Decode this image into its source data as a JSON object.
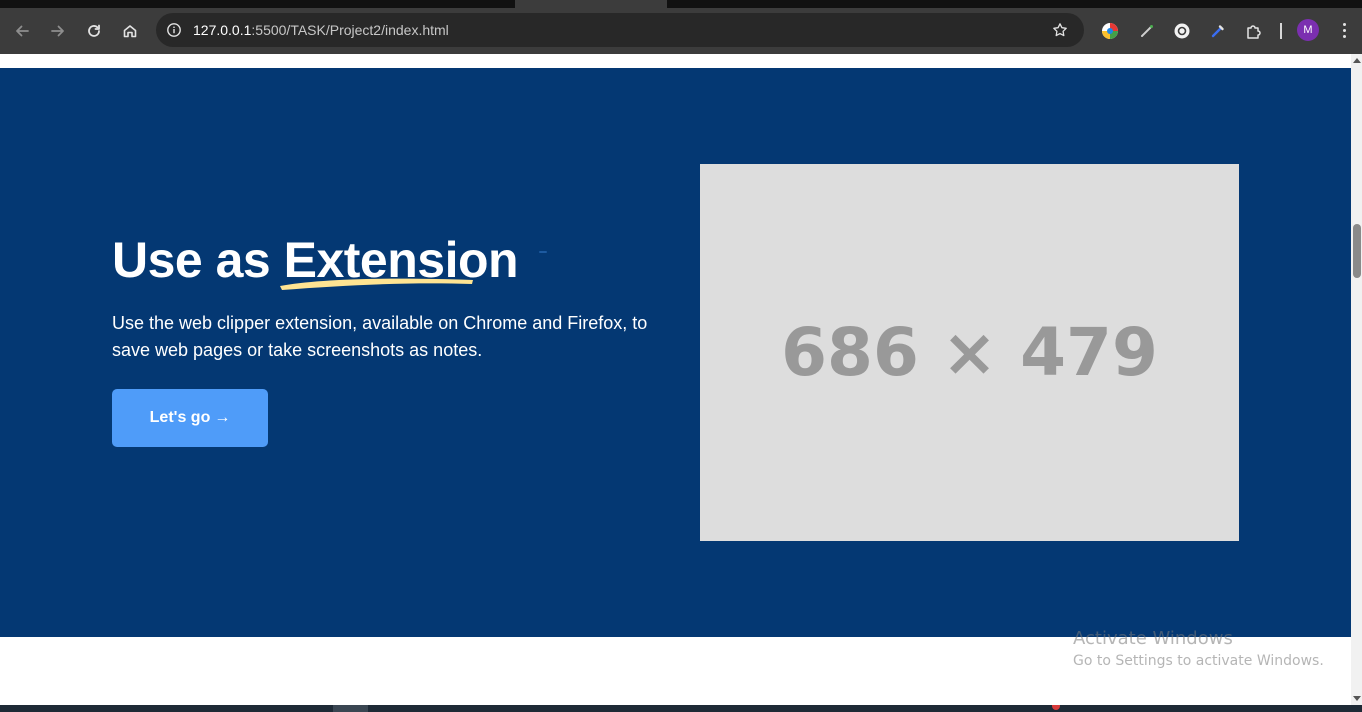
{
  "browser": {
    "url_host": "127.0.0.1",
    "url_rest": ":5500/TASK/Project2/index.html",
    "profile_initial": "M",
    "icons": [
      "back-icon",
      "forward-icon",
      "reload-icon",
      "home-icon",
      "site-info-icon",
      "bookmark-star-icon",
      "extension-icon",
      "puzzle-icon",
      "menu-icon"
    ]
  },
  "hero": {
    "title_prefix": "Use as ",
    "title_highlight": "Extension",
    "description": "Use the web clipper extension, available on Chrome and Firefox, to save web pages or take screenshots as notes.",
    "cta_label": "Let's go",
    "cta_arrow": "→",
    "image_placeholder_text": "686 × 479"
  },
  "watermark": {
    "title": "Activate Windows",
    "subtitle": "Go to Settings to activate Windows."
  },
  "colors": {
    "hero_bg": "#043873",
    "cta_bg": "#4f9cf9",
    "highlight_brush": "#ffe492",
    "placeholder_bg": "#dddddd",
    "placeholder_text": "#999999"
  }
}
